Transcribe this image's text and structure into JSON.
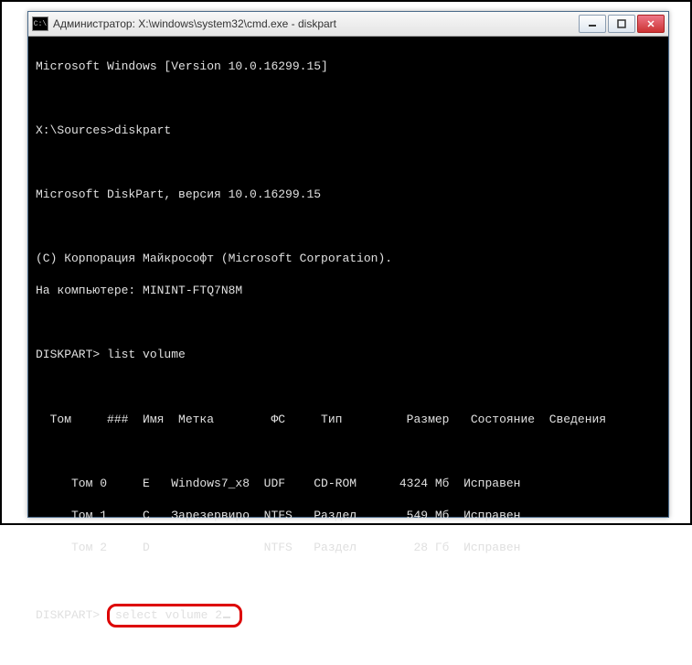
{
  "window": {
    "title": "Администратор: X:\\windows\\system32\\cmd.exe - diskpart"
  },
  "lines": {
    "version": "Microsoft Windows [Version 10.0.16299.15]",
    "prompt1": "X:\\Sources>diskpart",
    "diskpart_version": "Microsoft DiskPart, версия 10.0.16299.15",
    "copyright": "(C) Корпорация Майкрософт (Microsoft Corporation).",
    "computer": "На компьютере: MININT-FTQ7N8M",
    "prompt2": "DISKPART> list volume",
    "header": "  Том     ###  Имя  Метка        ФС     Тип         Размер   Состояние  Сведения",
    "divider": " ",
    "r0": "     Том 0     E   Windows7_x8  UDF    CD-ROM      4324 Мб  Исправен",
    "r1": "     Том 1     C   Зарезервиро  NTFS   Раздел       549 Мб  Исправен",
    "r2": "     Том 2     D                NTFS   Раздел        28 Гб  Исправен",
    "prompt3_prefix": "DISKPART> ",
    "prompt3_cmd": "select volume 2"
  }
}
